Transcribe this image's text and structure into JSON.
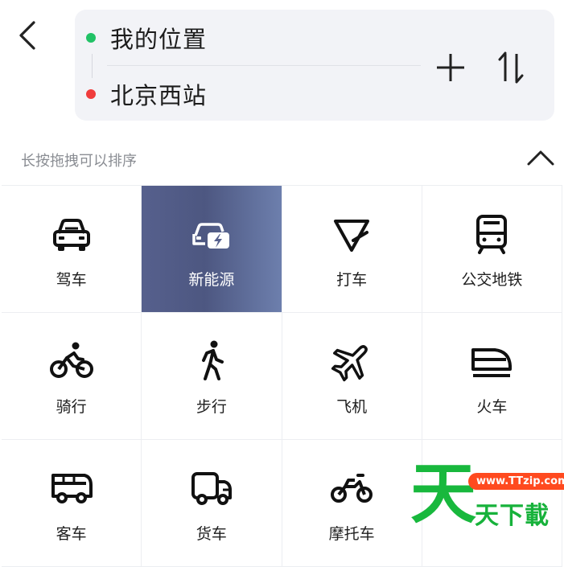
{
  "route": {
    "start": "我的位置",
    "end": "北京西站"
  },
  "panel": {
    "hint": "长按拖拽可以排序"
  },
  "modes": [
    {
      "label": "驾车",
      "icon": "car-icon"
    },
    {
      "label": "新能源",
      "icon": "electric-car-icon",
      "selected": true
    },
    {
      "label": "打车",
      "icon": "taxi-icon"
    },
    {
      "label": "公交地铁",
      "icon": "bus-icon"
    },
    {
      "label": "骑行",
      "icon": "bicycle-icon"
    },
    {
      "label": "步行",
      "icon": "walk-icon"
    },
    {
      "label": "飞机",
      "icon": "plane-icon"
    },
    {
      "label": "火车",
      "icon": "train-icon"
    },
    {
      "label": "客车",
      "icon": "coach-icon"
    },
    {
      "label": "货车",
      "icon": "truck-icon"
    },
    {
      "label": "摩托车",
      "icon": "motorcycle-icon"
    },
    {
      "label": "",
      "icon": ""
    }
  ],
  "watermark": {
    "big": "天",
    "url": "www.TTzip.com",
    "sub": "天下載"
  },
  "colors": {
    "start_dot": "#21c266",
    "end_dot": "#f03c3c",
    "selected_tile": "#56608d",
    "watermark_green": "#18b83d",
    "watermark_orange": "#ff4a1f"
  }
}
